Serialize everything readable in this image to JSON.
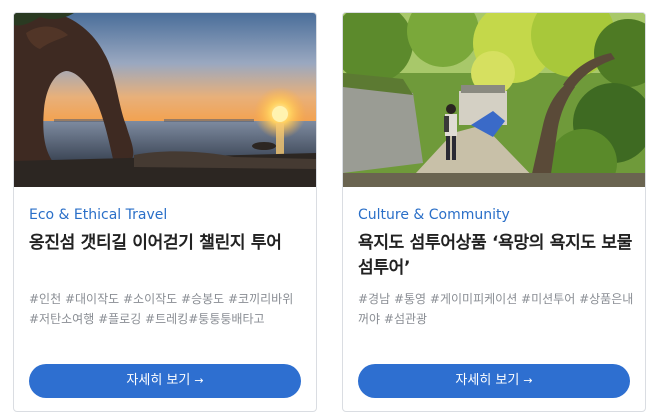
{
  "cards": [
    {
      "category": "Eco & Ethical Travel",
      "title": "옹진섬 갯티길 이어걷기 챌린지 투어",
      "tags": "#인천 #대이작도 #소이작도 #승봉도 #코끼리바위 #저탄소여행 #플로깅 #트레킹#퉁퉁퉁배타고",
      "button_label": "자세히 보기",
      "button_arrow": "→"
    },
    {
      "category": "Culture & Community",
      "title": "욕지도 섬투어상품 ‘욕망의 욕지도 보물섬투어’",
      "tags": "#경남 #통영 #게이미피케이션 #미션투어 #상품은내꺼야 #섬관광",
      "button_label": "자세히 보기",
      "button_arrow": "→"
    }
  ]
}
